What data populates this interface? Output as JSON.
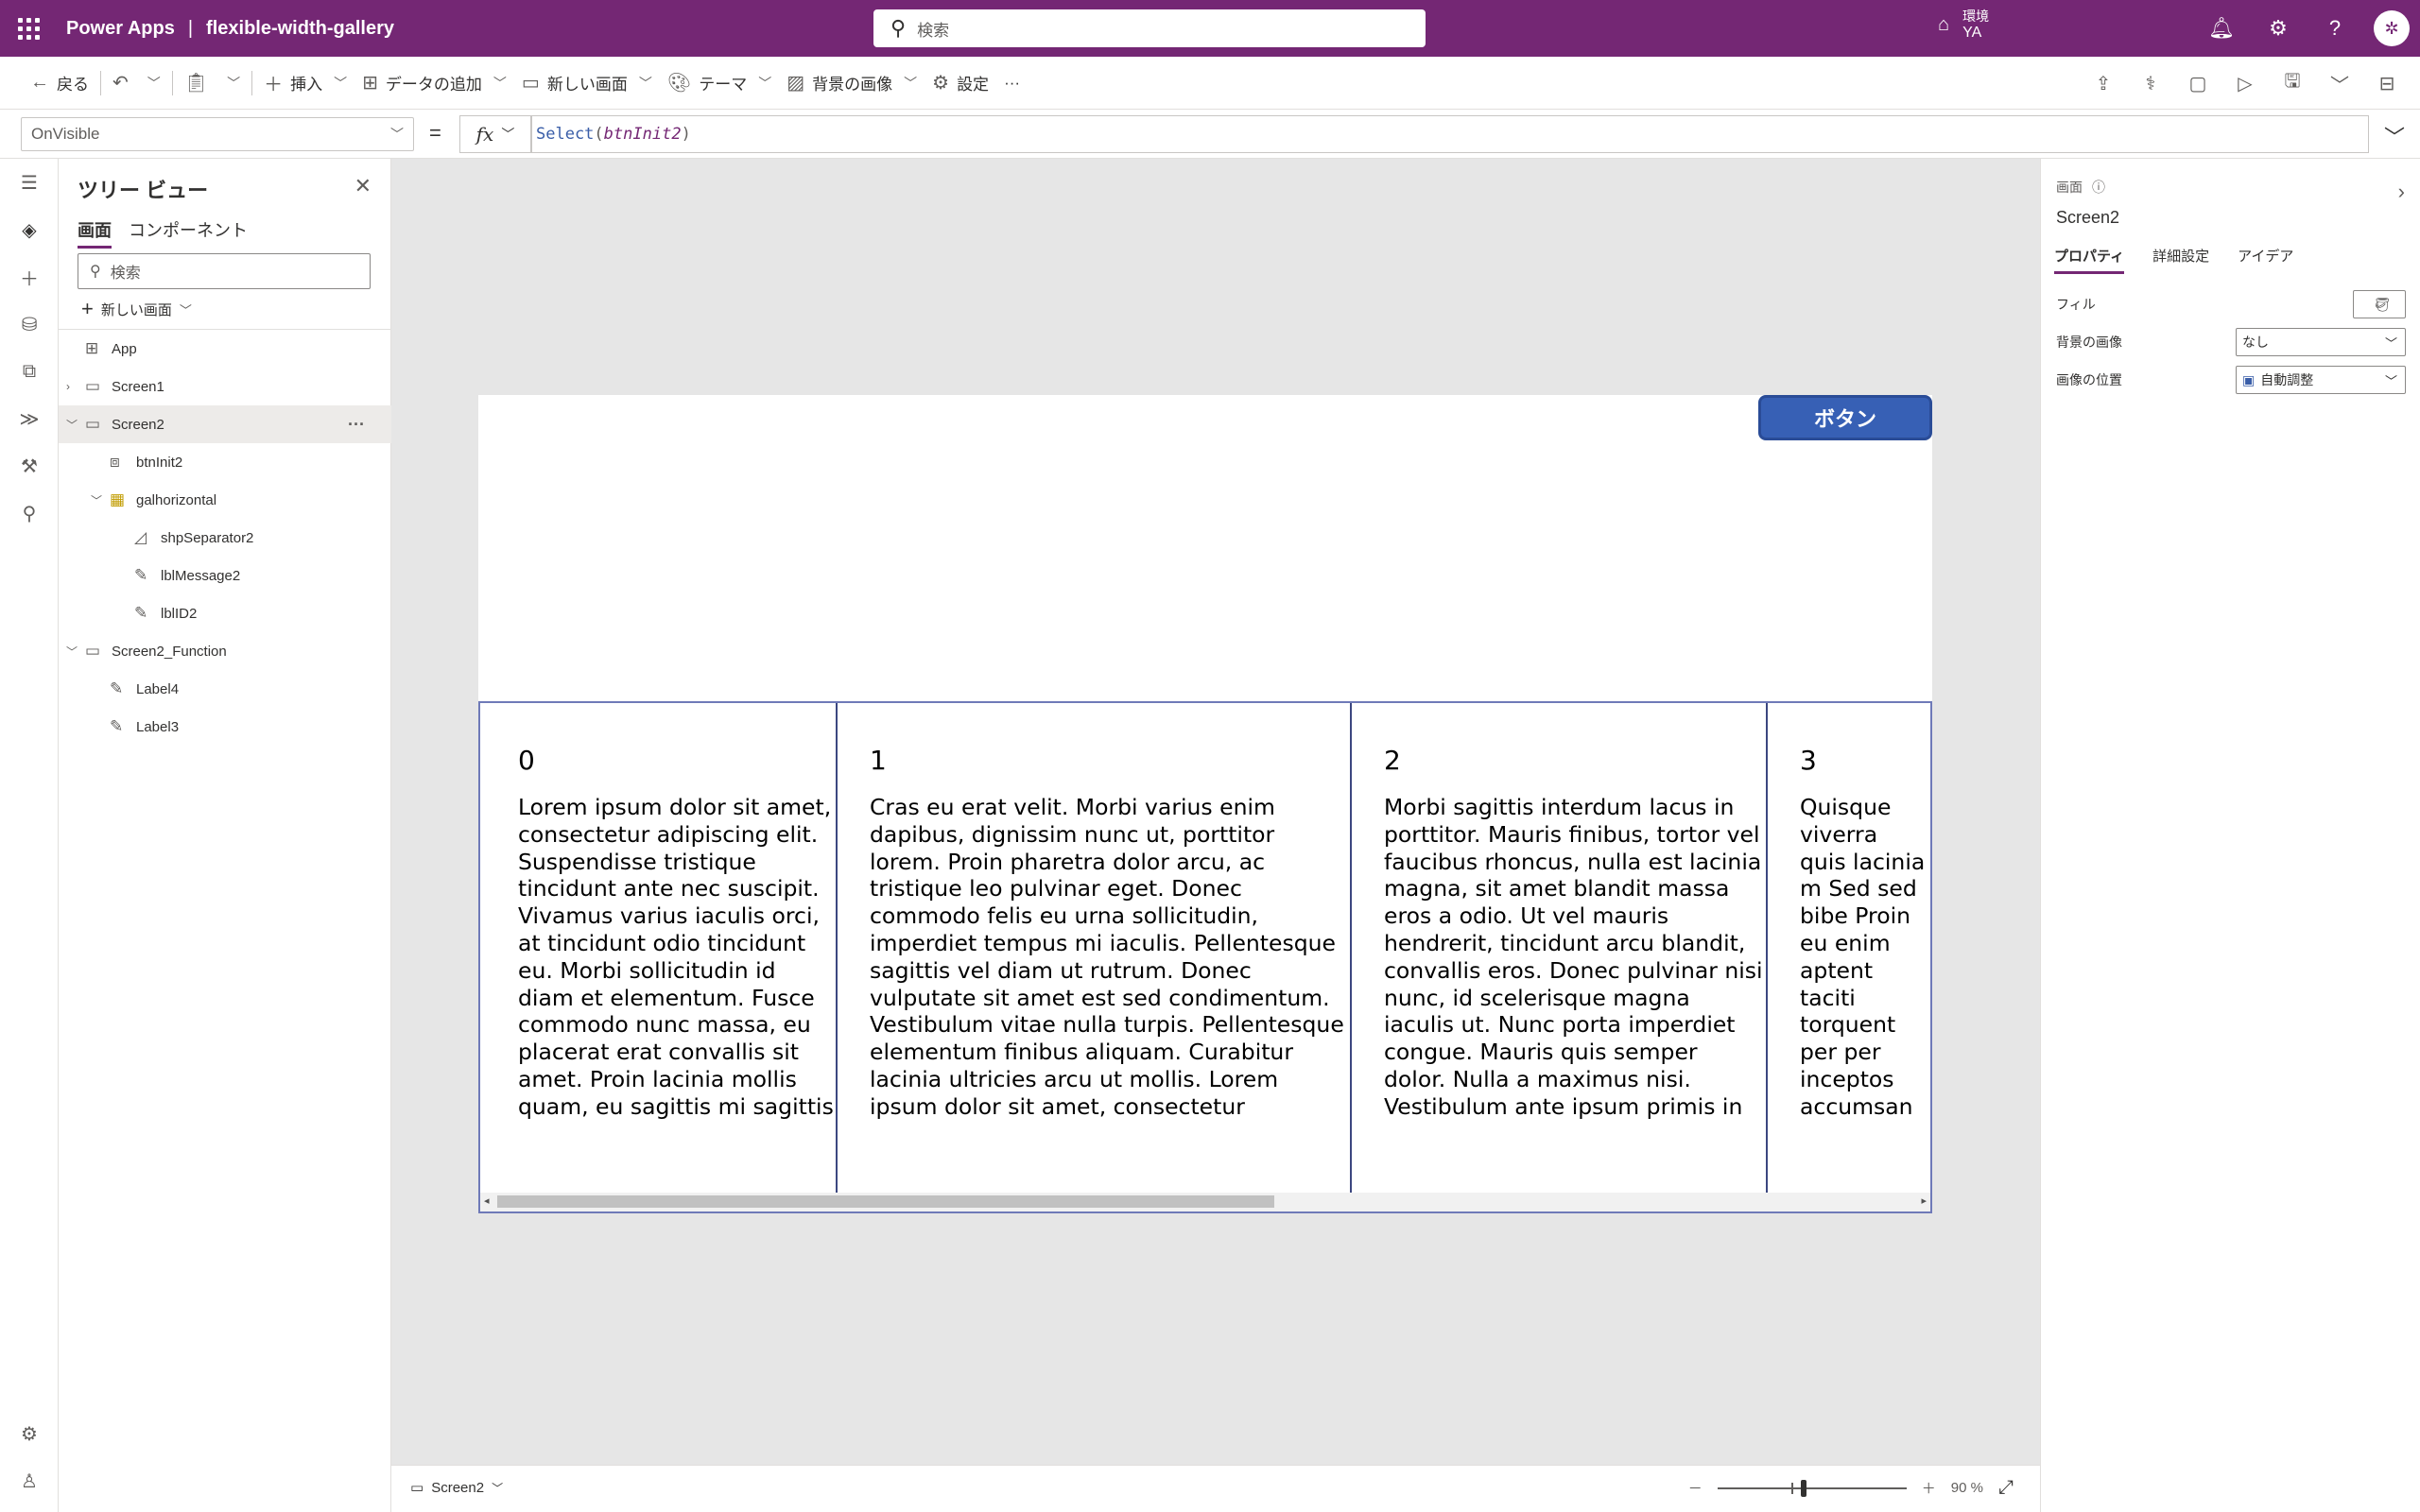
{
  "app": {
    "brand": "Power Apps",
    "separator": "|",
    "name": "flexible-width-gallery",
    "search_placeholder": "検索",
    "env_label": "環境",
    "env_value": "YA"
  },
  "toolbar": {
    "back": "戻る",
    "insert": "挿入",
    "add_data": "データの追加",
    "new_screen": "新しい画面",
    "theme": "テーマ",
    "background_image": "背景の画像",
    "settings": "設定",
    "more": "···"
  },
  "formula": {
    "property": "OnVisible",
    "equals": "=",
    "fx": "fx",
    "fn": "Select",
    "open": "(",
    "arg": "btnInit2",
    "close": ")"
  },
  "tree": {
    "title": "ツリー ビュー",
    "tab_screens": "画面",
    "tab_components": "コンポーネント",
    "search_placeholder": "検索",
    "new_screen": "新しい画面",
    "nodes": [
      {
        "label": "App"
      },
      {
        "label": "Screen1"
      },
      {
        "label": "Screen2"
      },
      {
        "label": "btnInit2"
      },
      {
        "label": "galhorizontal"
      },
      {
        "label": "shpSeparator2"
      },
      {
        "label": "lblMessage2"
      },
      {
        "label": "lblID2"
      },
      {
        "label": "Screen2_Function"
      },
      {
        "label": "Label4"
      },
      {
        "label": "Label3"
      }
    ]
  },
  "canvas": {
    "button_label": "ボタン",
    "gallery_items": [
      {
        "id": "0",
        "message": "Lorem ipsum dolor sit amet, consectetur adipiscing elit. Suspendisse tristique tincidunt ante nec suscipit. Vivamus varius iaculis orci, at tincidunt odio tincidunt eu. Morbi sollicitudin id diam et elementum. Fusce commodo nunc massa, eu placerat erat convallis sit amet. Proin lacinia mollis quam, eu sagittis mi sagittis eget. Quisque id felis"
      },
      {
        "id": "1",
        "message": "Cras eu erat velit. Morbi varius enim dapibus, dignissim nunc ut, porttitor lorem. Proin pharetra dolor arcu, ac tristique leo pulvinar eget. Donec commodo felis eu urna sollicitudin, imperdiet tempus mi iaculis. Pellentesque sagittis vel diam ut rutrum. Donec vulputate sit amet est sed condimentum. Vestibulum vitae nulla turpis. Pellentesque elementum finibus aliquam. Curabitur lacinia ultricies arcu ut mollis. Lorem ipsum dolor sit amet, consectetur adipiscing elit. Donec ac accumsan elit, eget porta lectus. Etiam"
      },
      {
        "id": "2",
        "message": "Morbi sagittis interdum lacus in porttitor. Mauris finibus, tortor vel faucibus rhoncus, nulla est lacinia magna, sit amet blandit massa eros a odio. Ut vel mauris hendrerit, tincidunt arcu blandit, convallis eros. Donec pulvinar nisi nunc, id scelerisque magna iaculis ut. Nunc porta imperdiet congue. Mauris quis semper dolor. Nulla a maximus nisi. Vestibulum ante ipsum primis in faucibus orci luctus et ultrices posuere cubilia curae; Curabitur"
      },
      {
        "id": "3",
        "message": "Quisque viverra quis lacinia m Sed sed bibe Proin eu enim aptent taciti torquent per per inceptos accumsan nu diam. Nam n eros pellente ac nec neque hendrerit ele Donec elit"
      }
    ]
  },
  "status": {
    "screen": "Screen2",
    "zoom": "90",
    "zoom_unit": "%"
  },
  "props": {
    "type_label": "画面",
    "name": "Screen2",
    "tab_properties": "プロパティ",
    "tab_advanced": "詳細設定",
    "tab_ideas": "アイデア",
    "fill_label": "フィル",
    "bgimage_label": "背景の画像",
    "bgimage_value": "なし",
    "imgpos_label": "画像の位置",
    "imgpos_value": "自動調整"
  },
  "colors": {
    "brand": "#742774",
    "button": "#3760b5",
    "gallery_border": "#6f7ab8"
  }
}
